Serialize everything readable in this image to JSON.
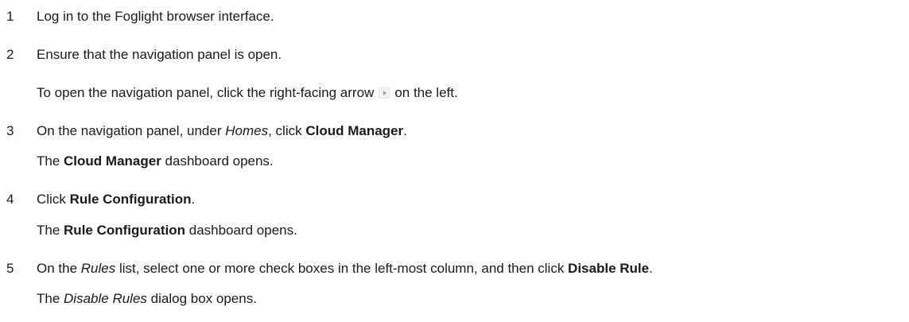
{
  "steps": [
    {
      "number": "1",
      "text": "Log in to the Foglight browser interface."
    },
    {
      "number": "2",
      "text": "Ensure that the navigation panel is open.",
      "note_before": "To open the navigation panel, click the right-facing arrow",
      "note_after": "on the left."
    },
    {
      "number": "3",
      "text_before": "On the navigation panel, under ",
      "italic_1": "Homes",
      "text_middle": ", click ",
      "bold_1": "Cloud Manager",
      "text_after": ".",
      "note_before": "The ",
      "note_bold": "Cloud Manager",
      "note_after": " dashboard opens."
    },
    {
      "number": "4",
      "text_before": "Click ",
      "bold_1": "Rule Configuration",
      "text_after": ".",
      "note_before": "The ",
      "note_bold": "Rule Configuration",
      "note_after": " dashboard opens."
    },
    {
      "number": "5",
      "text_before": "On the ",
      "italic_1": "Rules",
      "text_middle": " list, select one or more check boxes in the left-most column, and then click ",
      "bold_1": "Disable Rule",
      "text_after": ".",
      "note_before": "The ",
      "note_italic": "Disable Rules",
      "note_after": " dialog box opens."
    }
  ],
  "icons": {
    "inline_arrow": "right-facing-arrow-icon"
  }
}
